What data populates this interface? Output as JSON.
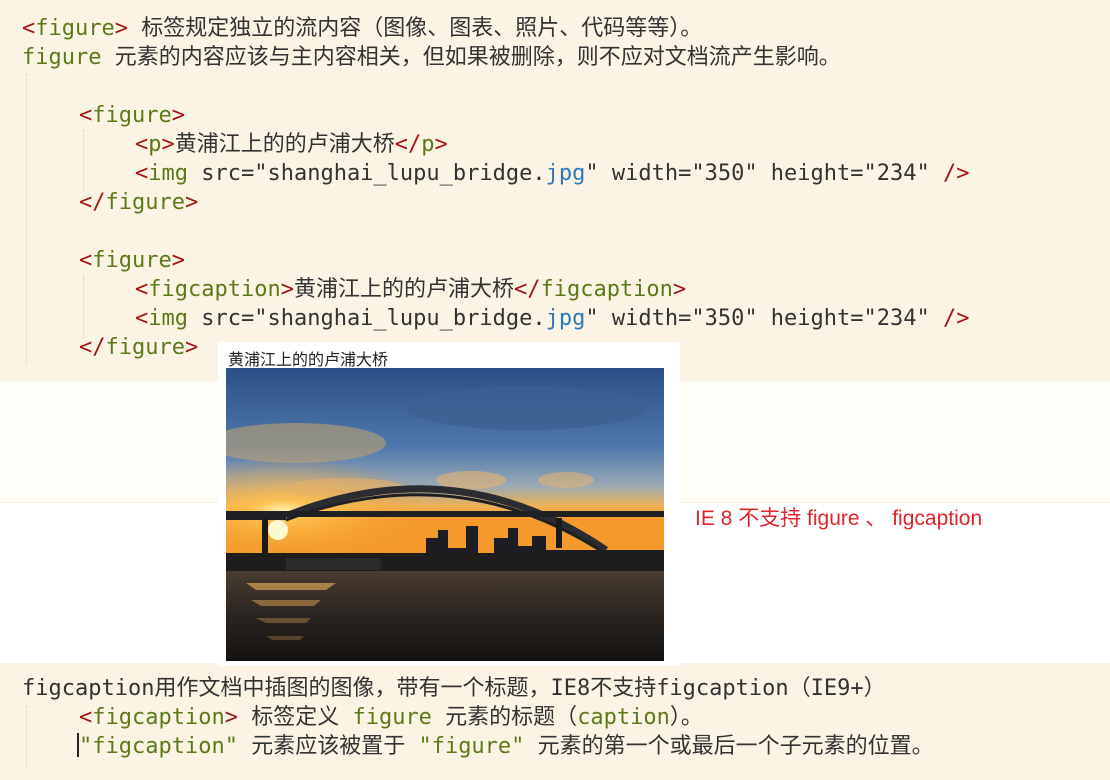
{
  "intro": {
    "line1_tag": "figure",
    "line1_text": " 标签规定独立的流内容（图像、图表、照片、代码等等）。",
    "line2_kw": "figure",
    "line2_text": " 元素的内容应该与主内容相关，但如果被删除，则不应对文档流产生影响。"
  },
  "code_example_1": {
    "figure_tag": "figure",
    "p_tag": "p",
    "p_text": "黄浦江上的的卢浦大桥",
    "img_tag": "img",
    "img_attrs_before": " src=\"shanghai_lupu_bridge.",
    "img_ext": "jpg",
    "img_attrs_after": "\" width=\"350\" height=\"234\" ",
    "self_close": "/>"
  },
  "code_example_2": {
    "figure_tag": "figure",
    "figcaption_tag": "figcaption",
    "figcaption_text": "黄浦江上的的卢浦大桥",
    "img_tag": "img",
    "img_attrs_before": " src=\"shanghai_lupu_bridge.",
    "img_ext": "jpg",
    "img_attrs_after": "\" width=\"350\" height=\"234\" ",
    "self_close": "/>"
  },
  "demo": {
    "caption": "黄浦江上的的卢浦大桥",
    "photo_alt": "Lupu Bridge over Huangpu River at sunset"
  },
  "ie_note": "IE 8 不支持 figure 、 figcaption",
  "figcaption_notes": {
    "line1": "figcaption用作文档中插图的图像，带有一个标题，IE8不支持figcaption（IE9+）",
    "line2_tag": "figcaption",
    "line2_text": " 标签定义 ",
    "line2_kw": "figure",
    "line2_text2": " 元素的标题（",
    "line2_kw2": "caption",
    "line2_text3": "）。",
    "line3_kw1": "\"figcaption\"",
    "line3_text1": " 元素应该被置于 ",
    "line3_kw2": "\"figure\"",
    "line3_text2": " 元素的第一个或最后一个子元素的位置。"
  },
  "colors": {
    "background": "#fbf4e4",
    "tag": "#5c7a1a",
    "punct": "#a31515",
    "ext": "#2a7ac0",
    "note": "#e0242b"
  }
}
